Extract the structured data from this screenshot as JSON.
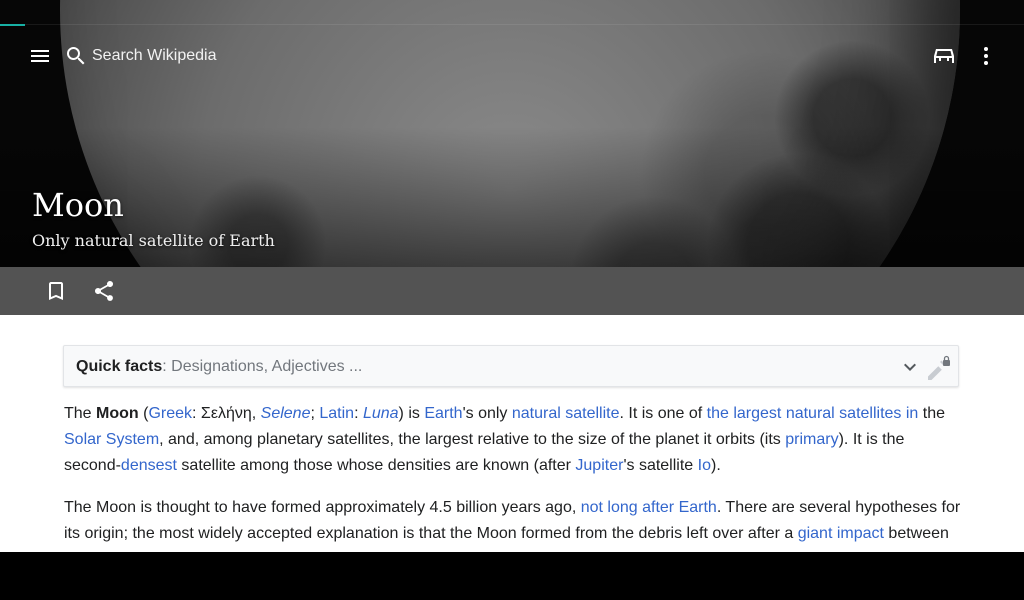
{
  "top_bar": {
    "search_placeholder": "Search Wikipedia"
  },
  "article": {
    "title": "Moon",
    "description": "Only natural satellite of Earth"
  },
  "quick_facts": {
    "label": "Quick facts",
    "separator": ": ",
    "summary": "Designations, Adjectives ..."
  },
  "paragraph1": {
    "t0": "The ",
    "moon_bold": "Moon",
    "t1": " (",
    "greek_link": "Greek",
    "t2": ": Σελήνη, ",
    "selene_link": "Selene",
    "t3": "; ",
    "latin_link": "Latin",
    "t4": ": ",
    "luna_link": "Luna",
    "t5": ") is ",
    "earth_link": "Earth",
    "t6": "'s only ",
    "natural_satellite_link": "natural satellite",
    "t7": ". It is one of ",
    "largest_link": "the largest natural satellites in",
    "t8": " the ",
    "solar_system_link": "Solar System",
    "t9": ", and, among planetary satellites, the largest relative to the size of the planet it orbits (its ",
    "primary_link": "primary",
    "t10": "). It is the second-",
    "densest_link": "densest",
    "t11": " satellite among those whose densities are known (after ",
    "jupiter_link": "Jupiter",
    "t12": "'s satellite ",
    "io_link": "Io",
    "t13": ")."
  },
  "paragraph2": {
    "t0": "The Moon is thought to have formed approximately 4.5 billion years ago, ",
    "not_long_link": "not long after Earth",
    "t1": ". There are several hypotheses for its origin; the most widely accepted explanation is that the Moon formed from the debris left over after a ",
    "giant_impact_link": "giant impact",
    "t2": " between"
  },
  "colors": {
    "link": "#3366cc",
    "action_bar": "#535353",
    "progress_accent": "#18b0a4"
  },
  "icons": [
    "menu-icon",
    "search-icon",
    "reading-lists-icon",
    "overflow-menu-icon",
    "bookmark-icon",
    "share-icon",
    "chevron-down-icon",
    "edit-locked-icon"
  ]
}
